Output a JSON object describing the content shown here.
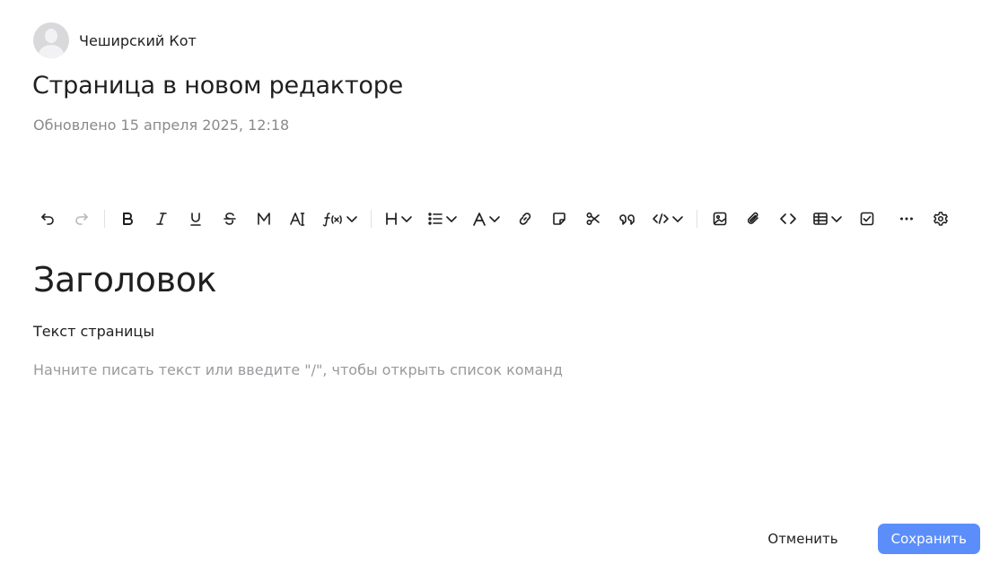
{
  "author": {
    "name": "Чеширский Кот"
  },
  "page": {
    "title": "Страница в новом редакторе",
    "updated": "Обновлено 15 апреля 2025, 12:18"
  },
  "toolbar": {
    "groups": [
      [
        "undo-icon",
        "redo-icon"
      ],
      [
        "bold-icon",
        "italic-icon",
        "underline-icon",
        "strikethrough-icon",
        "monospace-icon",
        "text-style-icon",
        "formula-icon"
      ],
      [
        "heading-icon",
        "list-icon",
        "text-color-icon",
        "link-icon",
        "note-icon",
        "cut-icon",
        "quote-icon",
        "code-embed-icon"
      ],
      [
        "image-icon",
        "attachment-icon",
        "code-icon",
        "table-icon",
        "checkbox-icon",
        "more-icon",
        "settings-icon"
      ]
    ],
    "heading_letter": "H",
    "text_color_letter": "A"
  },
  "editor": {
    "heading": "Заголовок",
    "paragraph": "Текст страницы",
    "placeholder": "Начните писать текст или введите \"/\", чтобы открыть список команд"
  },
  "actions": {
    "cancel_label": "Отменить",
    "save_label": "Сохранить"
  },
  "colors": {
    "accent": "#5b8efa",
    "muted_text": "#8a8a8e"
  }
}
